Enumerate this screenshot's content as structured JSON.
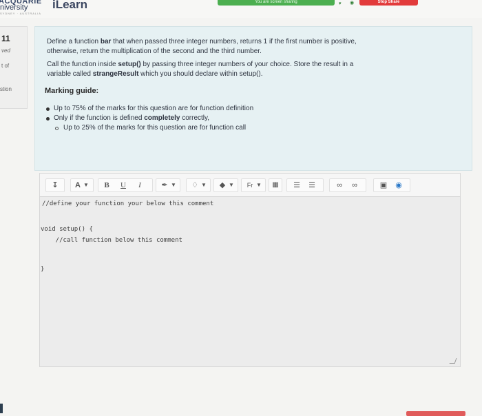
{
  "header": {
    "uni_top": "ACQUARIE",
    "uni_name": "niversity",
    "uni_sub": "SYDNEY · AUSTRALIA",
    "app_name": "iLearn",
    "share_text": "You are screen sharing",
    "stop_share": "Stop Share"
  },
  "sidebar": {
    "question_number": "11",
    "status": "ved",
    "mark": "t of",
    "flag": "stion"
  },
  "question": {
    "line1_pre": "Define a function ",
    "line1_bold": "bar",
    "line1_post": " that when passed three integer numbers, returns 1 if the first number is positive,",
    "line2": "otherwise, return the multiplication of the second and the third number.",
    "line3_pre": "Call the function inside ",
    "line3_bold": "setup()",
    "line3_post": " by passing three integer numbers of your choice. Store the result in a",
    "line4_pre": "variable called ",
    "line4_bold": "strangeResult",
    "line4_post": " which you should declare within setup().",
    "guide_title": "Marking guide:",
    "bullet1": "Up to 75% of the marks for this question are for function definition",
    "bullet2_pre": "Only if the function is defined ",
    "bullet2_bold": "completely",
    "bullet2_post": " correctly,",
    "sub_bullet": "Up to 25% of the marks for this question are for function call"
  },
  "toolbar": {
    "paragraph_icon": "paragraph-icon",
    "font_size_label": "A",
    "bold_label": "B",
    "underline_label": "U",
    "italic_label": "I",
    "font_family_label": "Fr"
  },
  "editor": {
    "line1": "//define your function your below this comment",
    "line2": "void setup() {",
    "line3": "    //call function below this comment",
    "line4": "}"
  },
  "colors": {
    "panel_bg": "#e6f1f3",
    "share_green": "#4caf50",
    "stop_red": "#e23b3b"
  }
}
